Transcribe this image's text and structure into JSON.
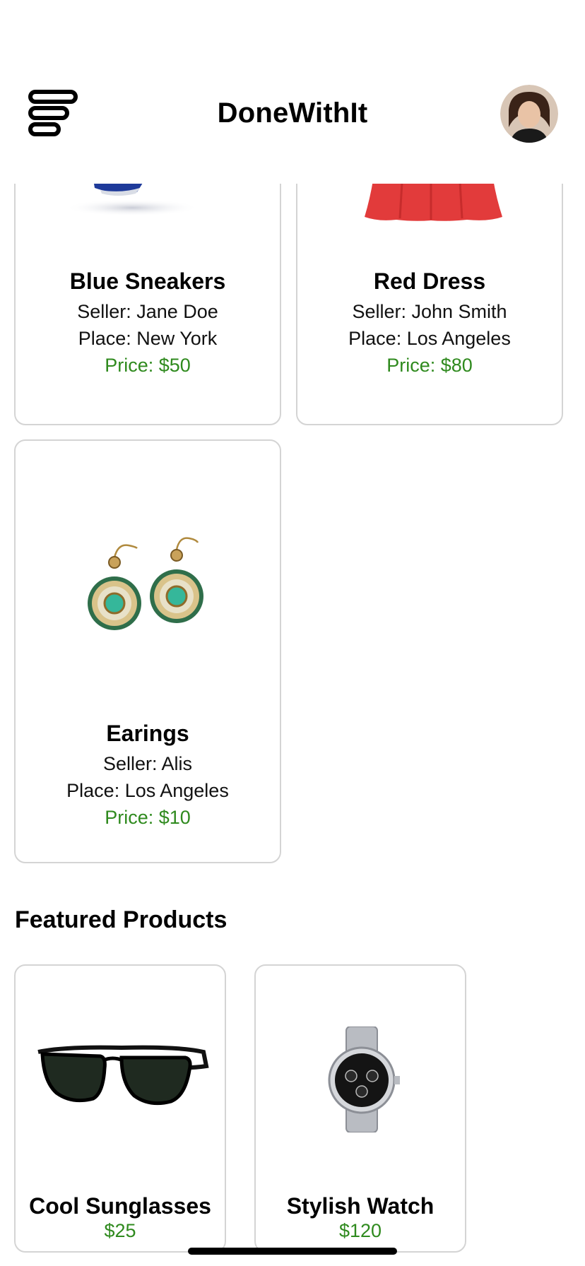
{
  "header": {
    "title": "DoneWithIt",
    "menu_icon": "menu-icon",
    "avatar_icon": "avatar"
  },
  "listings": [
    {
      "title": "Blue Sneakers",
      "seller": "Seller: Jane Doe",
      "place": "Place: New York",
      "price": "Price: $50"
    },
    {
      "title": "Red Dress",
      "seller": "Seller: John Smith",
      "place": "Place: Los Angeles",
      "price": "Price: $80"
    },
    {
      "title": "Earings",
      "seller": "Seller: Alis",
      "place": "Place: Los Angeles",
      "price": "Price: $10"
    }
  ],
  "featured": {
    "title": "Featured Products",
    "items": [
      {
        "title": "Cool Sunglasses",
        "price": "$25"
      },
      {
        "title": "Stylish Watch",
        "price": "$120"
      }
    ]
  },
  "colors": {
    "price_green": "#2f8a1e",
    "card_border": "#d4d4d4",
    "background": "#ffffff"
  }
}
